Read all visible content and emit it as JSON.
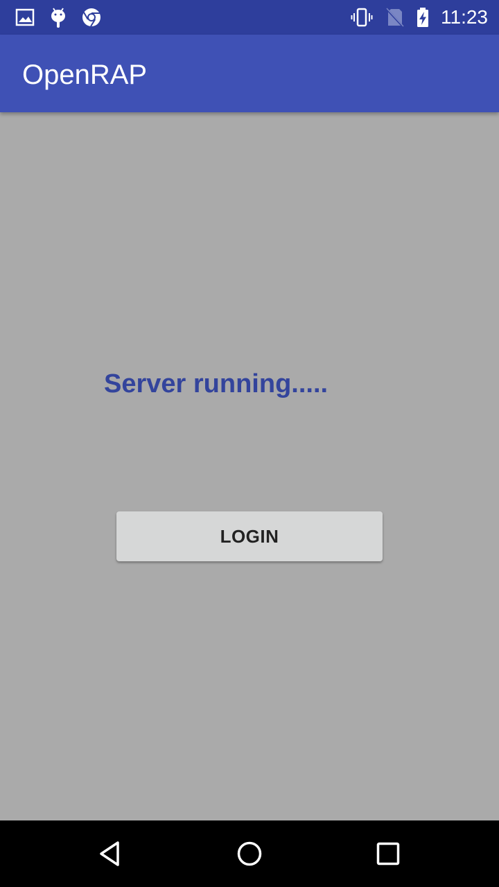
{
  "status_bar": {
    "time": "11:23",
    "left_icons": [
      "image-icon",
      "android-icon",
      "chrome-icon"
    ],
    "right_icons": [
      "vibrate-icon",
      "no-sim-icon",
      "battery-charging-icon"
    ]
  },
  "app_bar": {
    "title": "OpenRAP"
  },
  "main": {
    "status_text": "Server running.....",
    "login_label": "LOGIN"
  },
  "nav_bar": {
    "buttons": [
      "back-icon",
      "home-icon",
      "recents-icon"
    ]
  },
  "colors": {
    "status_bar": "#2e3e9c",
    "app_bar": "#3f51b5",
    "background": "#aaaaaa",
    "status_text": "#33449c",
    "button": "#d6d7d7"
  }
}
